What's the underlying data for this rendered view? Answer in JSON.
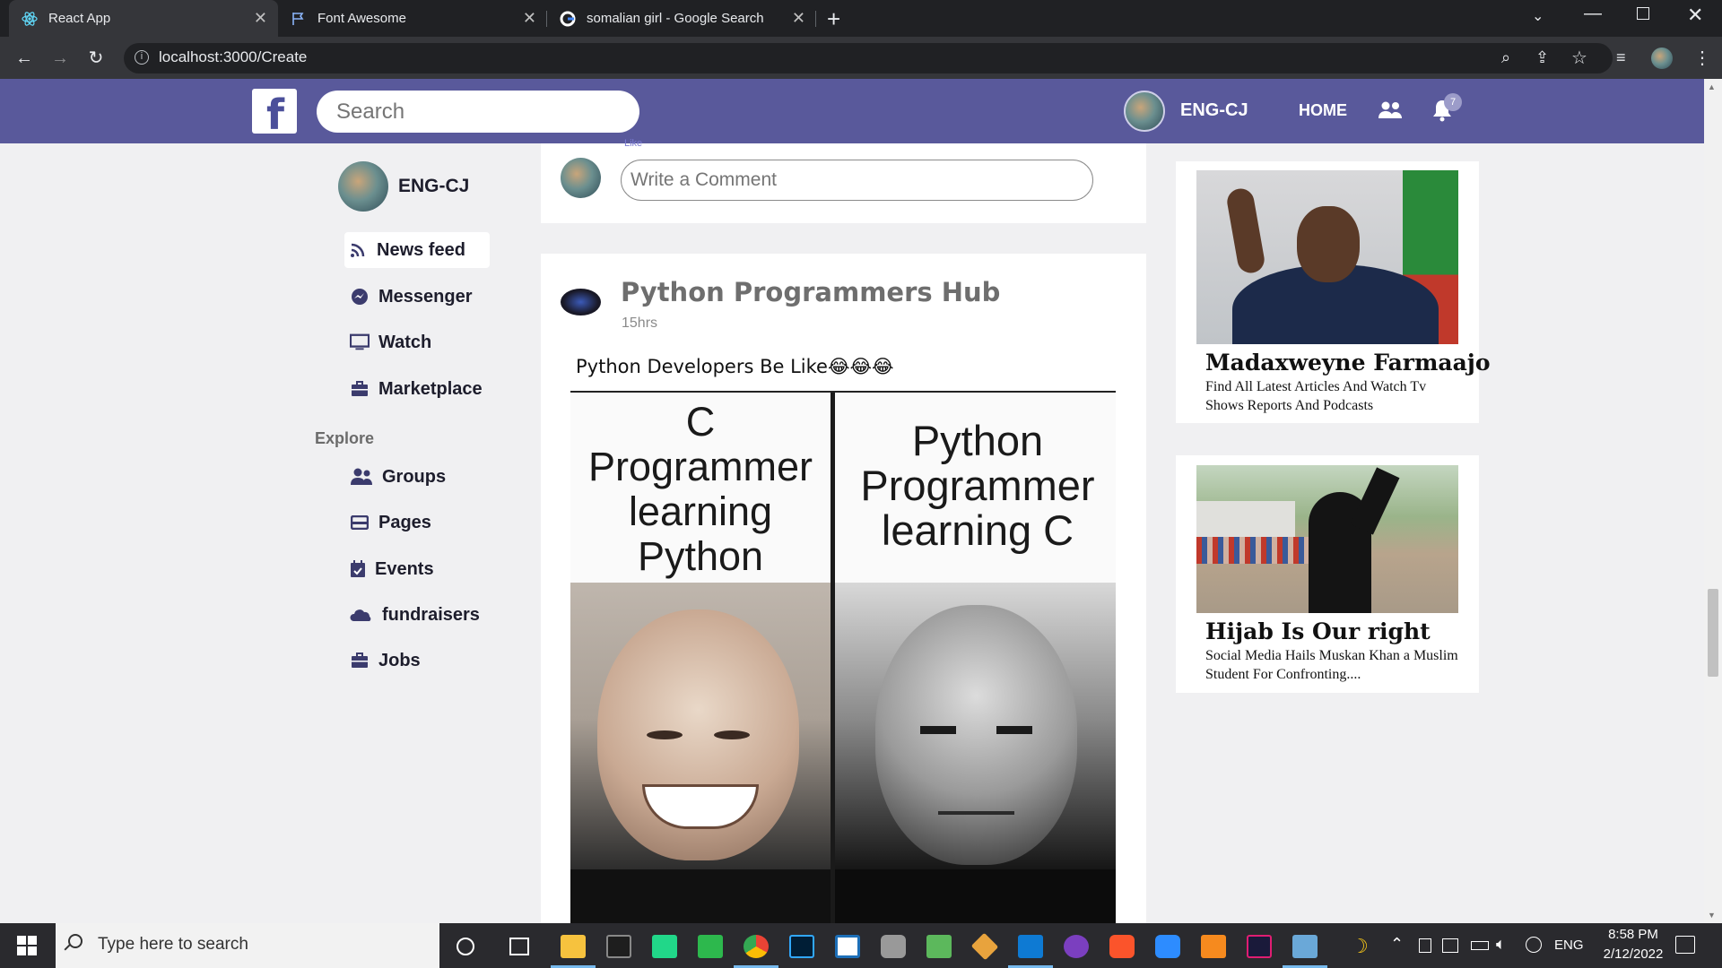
{
  "browser": {
    "tabs": [
      {
        "title": "React App",
        "active": true
      },
      {
        "title": "Font Awesome",
        "active": false
      },
      {
        "title": "somalian girl - Google Search",
        "active": false
      }
    ],
    "url": "localhost:3000/Create"
  },
  "header": {
    "logo": "f",
    "search_placeholder": "Search",
    "user_name": "ENG-CJ",
    "home_label": "HOME",
    "notification_count": "7"
  },
  "sidebar": {
    "user_name": "ENG-CJ",
    "items": [
      {
        "label": "News feed",
        "icon": "rss-icon"
      },
      {
        "label": "Messenger",
        "icon": "messenger-icon"
      },
      {
        "label": "Watch",
        "icon": "tv-icon"
      },
      {
        "label": "Marketplace",
        "icon": "briefcase-icon"
      }
    ],
    "explore_title": "Explore",
    "explore_items": [
      {
        "label": "Groups",
        "icon": "users-icon"
      },
      {
        "label": "Pages",
        "icon": "pages-icon"
      },
      {
        "label": "Events",
        "icon": "calendar-icon"
      },
      {
        "label": "fundraisers",
        "icon": "cloud-icon"
      },
      {
        "label": "Jobs",
        "icon": "briefcase-icon"
      }
    ]
  },
  "feed": {
    "like_label": "Like",
    "comment_placeholder": "Write a Comment",
    "post": {
      "author": "Python Programmers Hub",
      "time": "15hrs",
      "text": "Python Developers Be Like😂😂😂",
      "meme_left": "C Programmer learning Python",
      "meme_right": "Python Programmer learning C"
    }
  },
  "ads": [
    {
      "title": "Madaxweyne Farmaajo",
      "description": "Find All Latest Articles And Watch Tv Shows Reports And Podcasts"
    },
    {
      "title": "Hijab Is Our right",
      "description": "Social Media Hails Muskan Khan a Muslim Student For Confronting...."
    }
  ],
  "taskbar": {
    "search_placeholder": "Type here to search",
    "language": "ENG",
    "time": "8:58 PM",
    "date": "2/12/2022"
  },
  "colors": {
    "header_bg": "#59599b",
    "nav_icon": "#3b3b6d"
  }
}
